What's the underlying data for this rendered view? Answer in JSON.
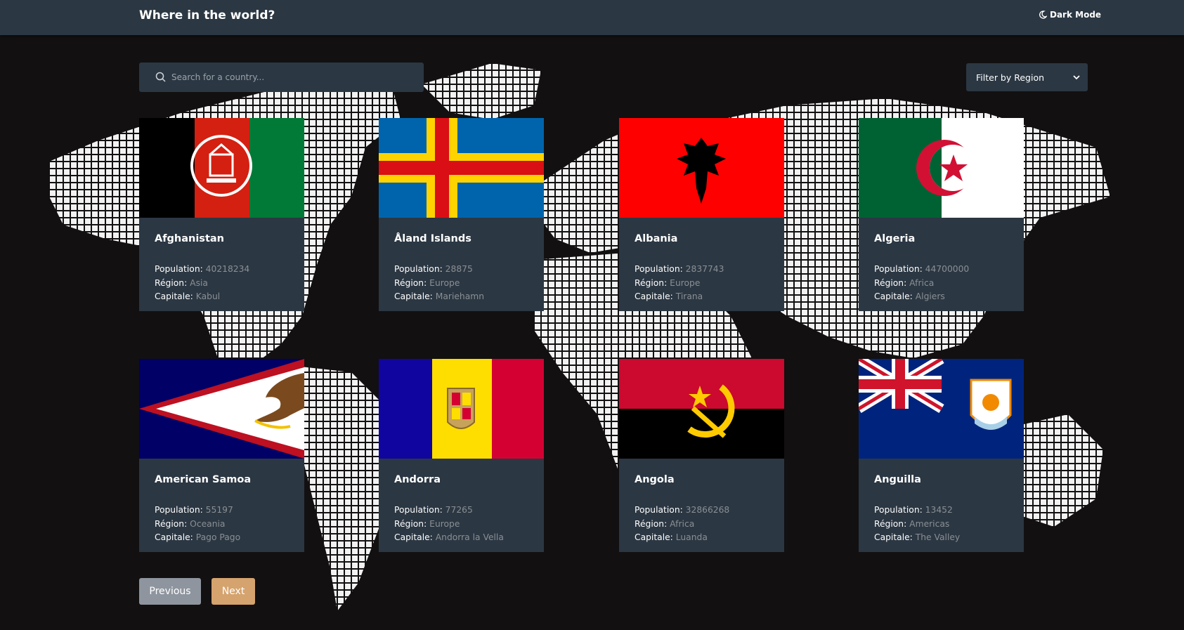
{
  "header": {
    "title": "Where in the world?",
    "dark_mode_label": "Dark Mode",
    "dark_mode_icon": "moon-icon"
  },
  "search": {
    "placeholder": "Search for a country...",
    "value": "",
    "icon": "search-icon"
  },
  "filter": {
    "label": "Filter by Region",
    "icon": "chevron-down-icon"
  },
  "labels": {
    "population": "Population:",
    "region": "Région:",
    "capital": "Capitale:"
  },
  "countries": [
    {
      "name": "Afghanistan",
      "population": "40218234",
      "region": "Asia",
      "capital": "Kabul",
      "flag": "flag-afghanistan"
    },
    {
      "name": "Åland Islands",
      "population": "28875",
      "region": "Europe",
      "capital": "Mariehamn",
      "flag": "flag-aland"
    },
    {
      "name": "Albania",
      "population": "2837743",
      "region": "Europe",
      "capital": "Tirana",
      "flag": "flag-albania"
    },
    {
      "name": "Algeria",
      "population": "44700000",
      "region": "Africa",
      "capital": "Algiers",
      "flag": "flag-algeria"
    },
    {
      "name": "American Samoa",
      "population": "55197",
      "region": "Oceania",
      "capital": "Pago Pago",
      "flag": "flag-american-samoa"
    },
    {
      "name": "Andorra",
      "population": "77265",
      "region": "Europe",
      "capital": "Andorra la Vella",
      "flag": "flag-andorra"
    },
    {
      "name": "Angola",
      "population": "32866268",
      "region": "Africa",
      "capital": "Luanda",
      "flag": "flag-angola"
    },
    {
      "name": "Anguilla",
      "population": "13452",
      "region": "Americas",
      "capital": "The Valley",
      "flag": "flag-anguilla"
    }
  ],
  "pagination": {
    "previous_label": "Previous",
    "next_label": "Next"
  },
  "colors": {
    "background": "#121011",
    "element": "#2b3743",
    "previous_button": "#8e959e",
    "next_button": "#d5a36d"
  }
}
